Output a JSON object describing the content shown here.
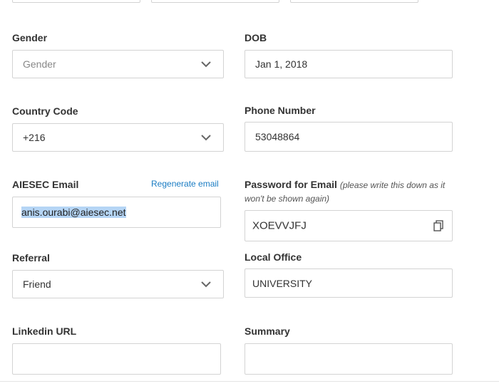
{
  "form": {
    "gender": {
      "label": "Gender",
      "value": "Gender"
    },
    "dob": {
      "label": "DOB",
      "value": "Jan 1, 2018"
    },
    "country_code": {
      "label": "Country Code",
      "value": "+216"
    },
    "phone": {
      "label": "Phone Number",
      "value": "53048864"
    },
    "aiesec_email": {
      "label": "AIESEC Email",
      "value": "anis.ourabi@aiesec.net",
      "regenerate_label": "Regenerate email"
    },
    "password": {
      "label": "Password for Email",
      "hint_line1": "(please write this down as it",
      "hint_line2": "won't be shown again)",
      "value": "XOEVVJFJ"
    },
    "referral": {
      "label": "Referral",
      "value": "Friend"
    },
    "local_office": {
      "label": "Local Office",
      "value": "UNIVERSITY"
    },
    "linkedin": {
      "label": "Linkedin URL",
      "value": ""
    },
    "summary": {
      "label": "Summary",
      "value": ""
    }
  },
  "colors": {
    "link": "#1a7cc3",
    "border": "#d3d3d3",
    "selection": "#b5d5f5"
  }
}
